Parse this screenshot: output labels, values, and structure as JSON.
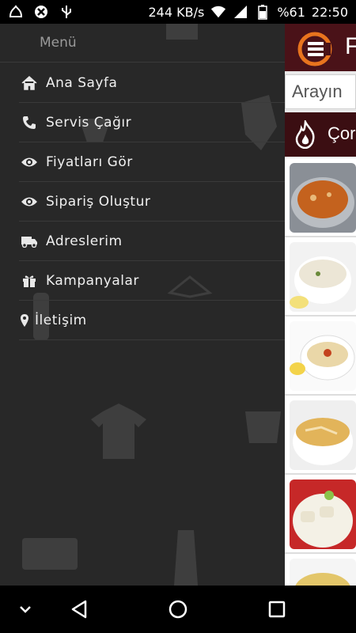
{
  "status_bar": {
    "speed": "244 KB/s",
    "battery": "%61",
    "time": "22:50",
    "icons": [
      "notification-icon",
      "blocked-icon",
      "usb-icon",
      "wifi-icon",
      "signal-icon",
      "battery-icon"
    ]
  },
  "drawer": {
    "title": "Menü",
    "items": [
      {
        "label": "Ana Sayfa",
        "icon": "home-icon"
      },
      {
        "label": "Servis Çağır",
        "icon": "phone-icon"
      },
      {
        "label": "Fiyatları Gör",
        "icon": "eye-icon"
      },
      {
        "label": "Sipariş Oluştur",
        "icon": "eye-icon"
      },
      {
        "label": "Adreslerim",
        "icon": "truck-icon"
      },
      {
        "label": "Kampanyalar",
        "icon": "gift-icon"
      },
      {
        "label": "İletişim",
        "icon": "map-pin-icon"
      }
    ]
  },
  "app": {
    "header_text": "F",
    "search_placeholder": "Arayın",
    "category_label": "Çor",
    "accent_color": "#4a1218",
    "logo_color": "#e8741e"
  },
  "nav_bar": {
    "buttons": [
      "chevron-down-icon",
      "back-icon",
      "home-circle-icon",
      "recents-icon"
    ]
  }
}
